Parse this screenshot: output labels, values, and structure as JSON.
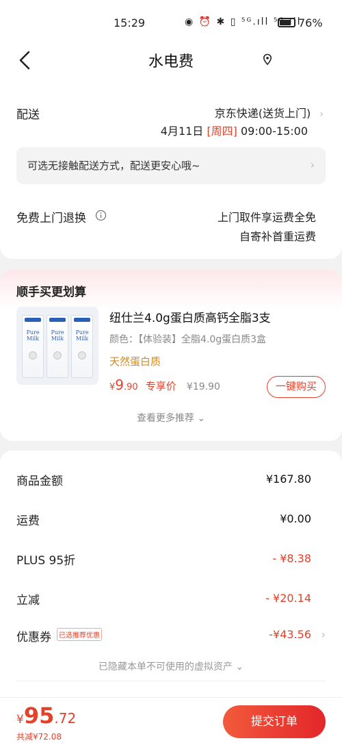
{
  "status_bar": {
    "time": "15:29",
    "icons": [
      "eye-icon",
      "alarm-icon",
      "bluetooth-icon",
      "vibrate-icon",
      "signal-5g-icon",
      "signal-5g-icon",
      "battery-icon"
    ],
    "icons_text": "◉ ⏰ ✱ ▯ ⁵ᴳ.ıll ⁵ᴳ.ıll",
    "battery_percent": "76%"
  },
  "nav": {
    "title": "水电费"
  },
  "delivery": {
    "label": "配送",
    "carrier": "京东快递(送货上门)",
    "date": "4月11日",
    "weekday": "[周四]",
    "time_range": "09:00-15:00",
    "contactless_tip": "可选无接触配送方式，配送更安心哦~"
  },
  "returns": {
    "label": "免费上门退换",
    "line1": "上门取件享运费全免",
    "line2": "自寄补首重运费"
  },
  "upsell": {
    "section_title": "顺手买更划算",
    "product_name": "纽仕兰4.0g蛋白质高钙全脂3支",
    "variant": "颜色：【体验装】全脂4.0g蛋白质3盒",
    "tag": "天然蛋白质",
    "price_yen": "¥",
    "price_int": "9",
    "price_dec": ".90",
    "price_label": "专享价",
    "original_price": "¥19.90",
    "buy_button": "一键购买",
    "see_more": "查看更多推荐",
    "carton_brand_text": "Pure Milk"
  },
  "summary": {
    "rows": [
      {
        "label": "商品金额",
        "value": "¥167.80"
      },
      {
        "label": "运费",
        "value": "¥0.00"
      },
      {
        "label": "PLUS 95折",
        "value": "- ¥8.38"
      },
      {
        "label": "立减",
        "value": "- ¥20.14"
      },
      {
        "label": "优惠券",
        "tag": "已选推荐优惠",
        "value": "-¥43.56"
      }
    ],
    "hidden_assets": "已隐藏本单不可使用的虚拟资产"
  },
  "footer": {
    "yen": "¥",
    "total_int": "95",
    "total_dec": ".72",
    "saved": "共减¥72.08",
    "submit": "提交订单"
  },
  "colors": {
    "accent": "#e3412a",
    "background": "#f2f2f2"
  }
}
